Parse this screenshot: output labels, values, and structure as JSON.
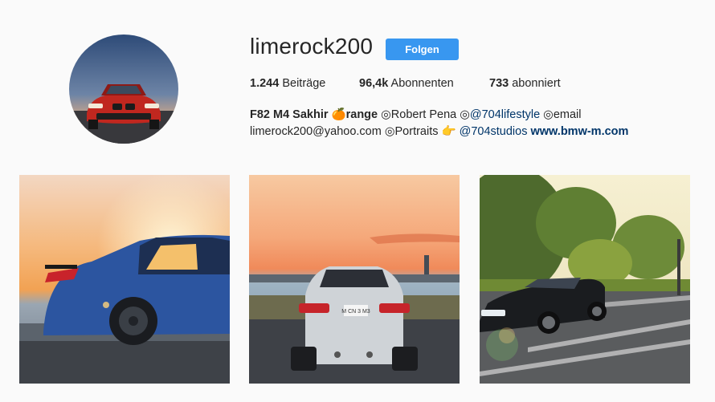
{
  "profile": {
    "username": "limerock200",
    "follow_label": "Folgen",
    "stats": [
      {
        "count": "1.244",
        "label": "Beiträge"
      },
      {
        "count": "96,4k",
        "label": "Abonnenten"
      },
      {
        "count": "733",
        "label": "abonniert"
      }
    ],
    "bio": {
      "name": "F82 M4 Sakhir",
      "emoji": "🍊",
      "name_rest": "range",
      "seg1": " ◎Robert Pena ◎",
      "tag1": "@704lifestyle",
      "seg2": " ◎email",
      "line2_start": "limerock200@yahoo.com ◎Portraits 👉 ",
      "tag2": "@704studios",
      "link": "www.bmw-m.com"
    }
  },
  "posts": [
    {
      "subject": "blue BMW side view at sunset"
    },
    {
      "subject": "white BMW M3 rear view at sunset",
      "plate": "M CN 3 M3"
    },
    {
      "subject": "black BMW M3 in parking lot"
    }
  ],
  "colors": {
    "accent": "#3897f0",
    "link": "#003569",
    "background": "#fafafa"
  }
}
